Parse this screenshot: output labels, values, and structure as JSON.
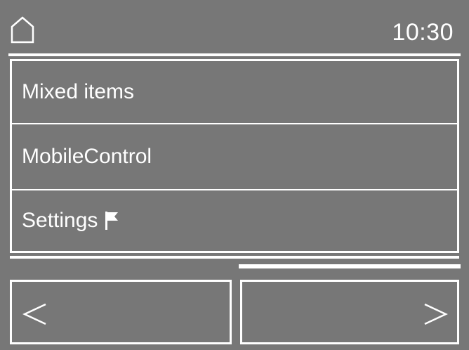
{
  "header": {
    "home_icon": "home-icon",
    "time": "10:30"
  },
  "menu": {
    "items": [
      {
        "label": "Mixed items"
      },
      {
        "label": "MobileControl"
      },
      {
        "label": "Settings",
        "icon": "flag-icon"
      }
    ]
  },
  "scroll": {
    "position_fraction": 1.0,
    "visible_fraction": 1.0
  },
  "navigation": {
    "prev_icon": "chevron-left-icon",
    "next_icon": "chevron-right-icon"
  },
  "colors": {
    "background": "#777777",
    "foreground": "#ffffff"
  }
}
